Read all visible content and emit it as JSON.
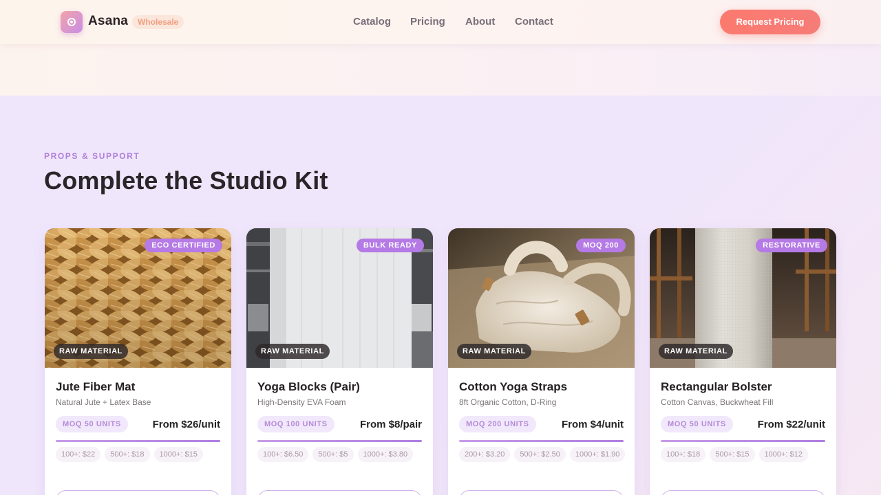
{
  "header": {
    "brand": "Asana",
    "badge": "Wholesale",
    "nav": [
      "Catalog",
      "Pricing",
      "About",
      "Contact"
    ],
    "cta": "Request Pricing"
  },
  "section": {
    "eyebrow": "PROPS & SUPPORT",
    "title": "Complete the Studio Kit"
  },
  "products": [
    {
      "name": "Jute Fiber Mat",
      "spec": "Natural Jute + Latex Base",
      "tag": "ECO CERTIFIED",
      "material": "RAW MATERIAL",
      "moq": "MOQ 50 UNITS",
      "price": "From $26/unit",
      "tiers": [
        "100+: $22",
        "500+: $18",
        "1000+: $15"
      ]
    },
    {
      "name": "Yoga Blocks (Pair)",
      "spec": "High-Density EVA Foam",
      "tag": "BULK READY",
      "material": "RAW MATERIAL",
      "moq": "MOQ 100 UNITS",
      "price": "From $8/pair",
      "tiers": [
        "100+: $6.50",
        "500+: $5",
        "1000+: $3.80"
      ]
    },
    {
      "name": "Cotton Yoga Straps",
      "spec": "8ft Organic Cotton, D-Ring",
      "tag": "MOQ 200",
      "material": "RAW MATERIAL",
      "moq": "MOQ 200 UNITS",
      "price": "From $4/unit",
      "tiers": [
        "200+: $3.20",
        "500+: $2.50",
        "1000+: $1.90"
      ]
    },
    {
      "name": "Rectangular Bolster",
      "spec": "Cotton Canvas, Buckwheat Fill",
      "tag": "RESTORATIVE",
      "material": "RAW MATERIAL",
      "moq": "MOQ 50 UNITS",
      "price": "From $22/unit",
      "tiers": [
        "100+: $18",
        "500+: $15",
        "1000+: $12"
      ]
    }
  ]
}
